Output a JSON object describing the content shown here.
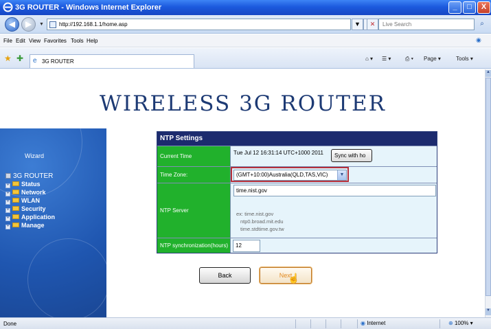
{
  "window": {
    "title": "3G ROUTER - Windows Internet Explorer",
    "minimize_glyph": "_",
    "maximize_glyph": "□",
    "close_glyph": "X"
  },
  "address": {
    "url": "http://192.168.1.1/home.asp",
    "search_placeholder": "Live Search",
    "back_glyph": "◀",
    "forward_glyph": "▶",
    "dropdown_glyph": "▼",
    "go_glyph": "⇆",
    "stop_glyph": "✕",
    "search_glyph": "⌕"
  },
  "menu": {
    "items": [
      "File",
      "Edit",
      "View",
      "Favorites",
      "Tools",
      "Help"
    ]
  },
  "favorites_bar": {
    "tab_label": "3G ROUTER",
    "home_label": "⌂ ▾",
    "feeds_label": "☰ ▾",
    "print_label": "⎙ ▾",
    "page_label": "Page ▾",
    "tools_label": "Tools ▾"
  },
  "page": {
    "brand": "WIRELESS 3G ROUTER",
    "sidebar": {
      "wizard": "Wizard",
      "root": "3G ROUTER",
      "items": [
        "Status",
        "Network",
        "WLAN",
        "Security",
        "Application",
        "Manage"
      ]
    },
    "ntp": {
      "header": "NTP Settings",
      "current_time_label": "Current Time",
      "current_time_value": "Tue Jul 12 16:31:14 UTC+1000 2011",
      "sync_button": "Sync with ho",
      "time_zone_label": "Time Zone:",
      "time_zone_value": "(GMT+10:00)Australia(QLD,TAS,VIC)",
      "ntp_server_label": "NTP Server",
      "ntp_server_value": "time.nist.gov",
      "examples": [
        "ex: time.nist.gov",
        "ntp0.broad.mit.edu",
        "time.stdtime.gov.tw"
      ],
      "sync_hours_label": "NTP synchronization(hours)",
      "sync_hours_value": "12"
    },
    "buttons": {
      "back": "Back",
      "next": "Next"
    }
  },
  "status_bar": {
    "status": "Done",
    "zone": "Internet",
    "zoom": "100%"
  }
}
